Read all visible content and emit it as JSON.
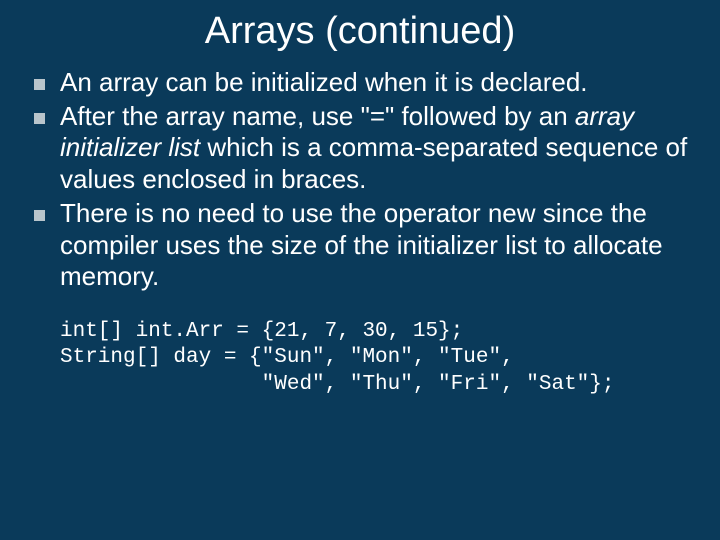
{
  "title": "Arrays (continued)",
  "bullets": {
    "b1": "An array can be initialized when it is declared.",
    "b2_prefix": "After the array name, use \"=\" followed by an ",
    "b2_italic": "array initializer list",
    "b2_suffix": " which is a comma-separated sequence of values enclosed in braces.",
    "b3": "There is no need to use the operator new since the compiler uses the size of the initializer list to allocate memory."
  },
  "code": "int[] int.Arr = {21, 7, 30, 15};\nString[] day = {\"Sun\", \"Mon\", \"Tue\",\n                \"Wed\", \"Thu\", \"Fri\", \"Sat\"};"
}
